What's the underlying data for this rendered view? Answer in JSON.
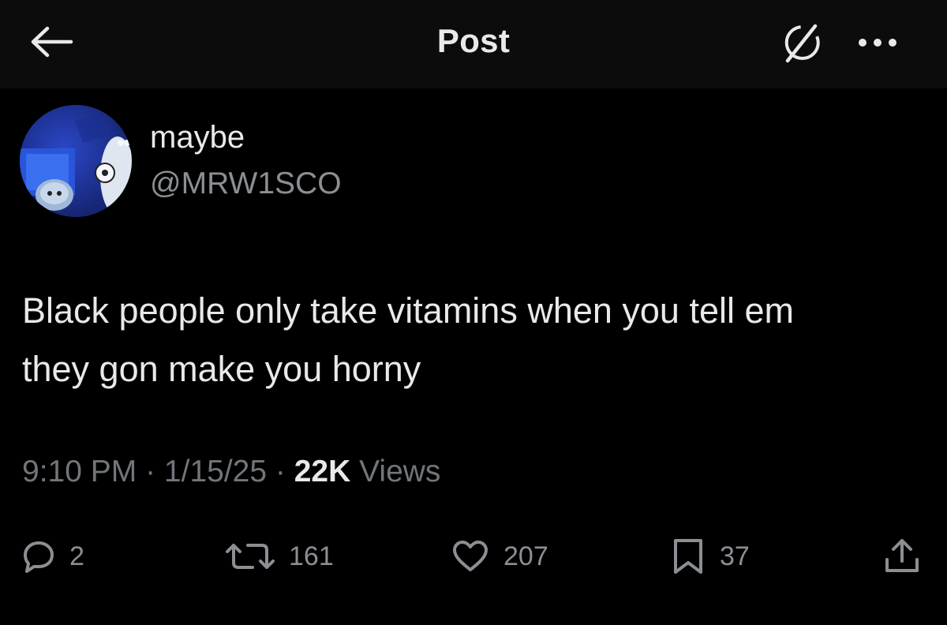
{
  "header": {
    "title": "Post",
    "back_icon": "arrow-left-icon",
    "grok_icon": "grok-icon",
    "more_icon": "more-horizontal-icon"
  },
  "post": {
    "author": {
      "display_name": "maybe",
      "handle": "@MRW1SCO",
      "avatar_icon": "avatar-image"
    },
    "text_line_1": "Black people only take vitamins when you tell em",
    "text_line_2": "they gon make you horny",
    "meta": {
      "time": "9:10 PM",
      "sep1": " · ",
      "date": "1/15/25",
      "sep2": " · ",
      "views_count": "22K",
      "views_label": " Views"
    },
    "actions": {
      "replies": "2",
      "reposts": "161",
      "likes": "207",
      "bookmarks": "37"
    }
  },
  "colors": {
    "background": "#000000",
    "header_background": "#0c0c0c",
    "primary_text": "#e7e9ea",
    "secondary_text": "#71767b",
    "icon": "#8b8f94"
  }
}
